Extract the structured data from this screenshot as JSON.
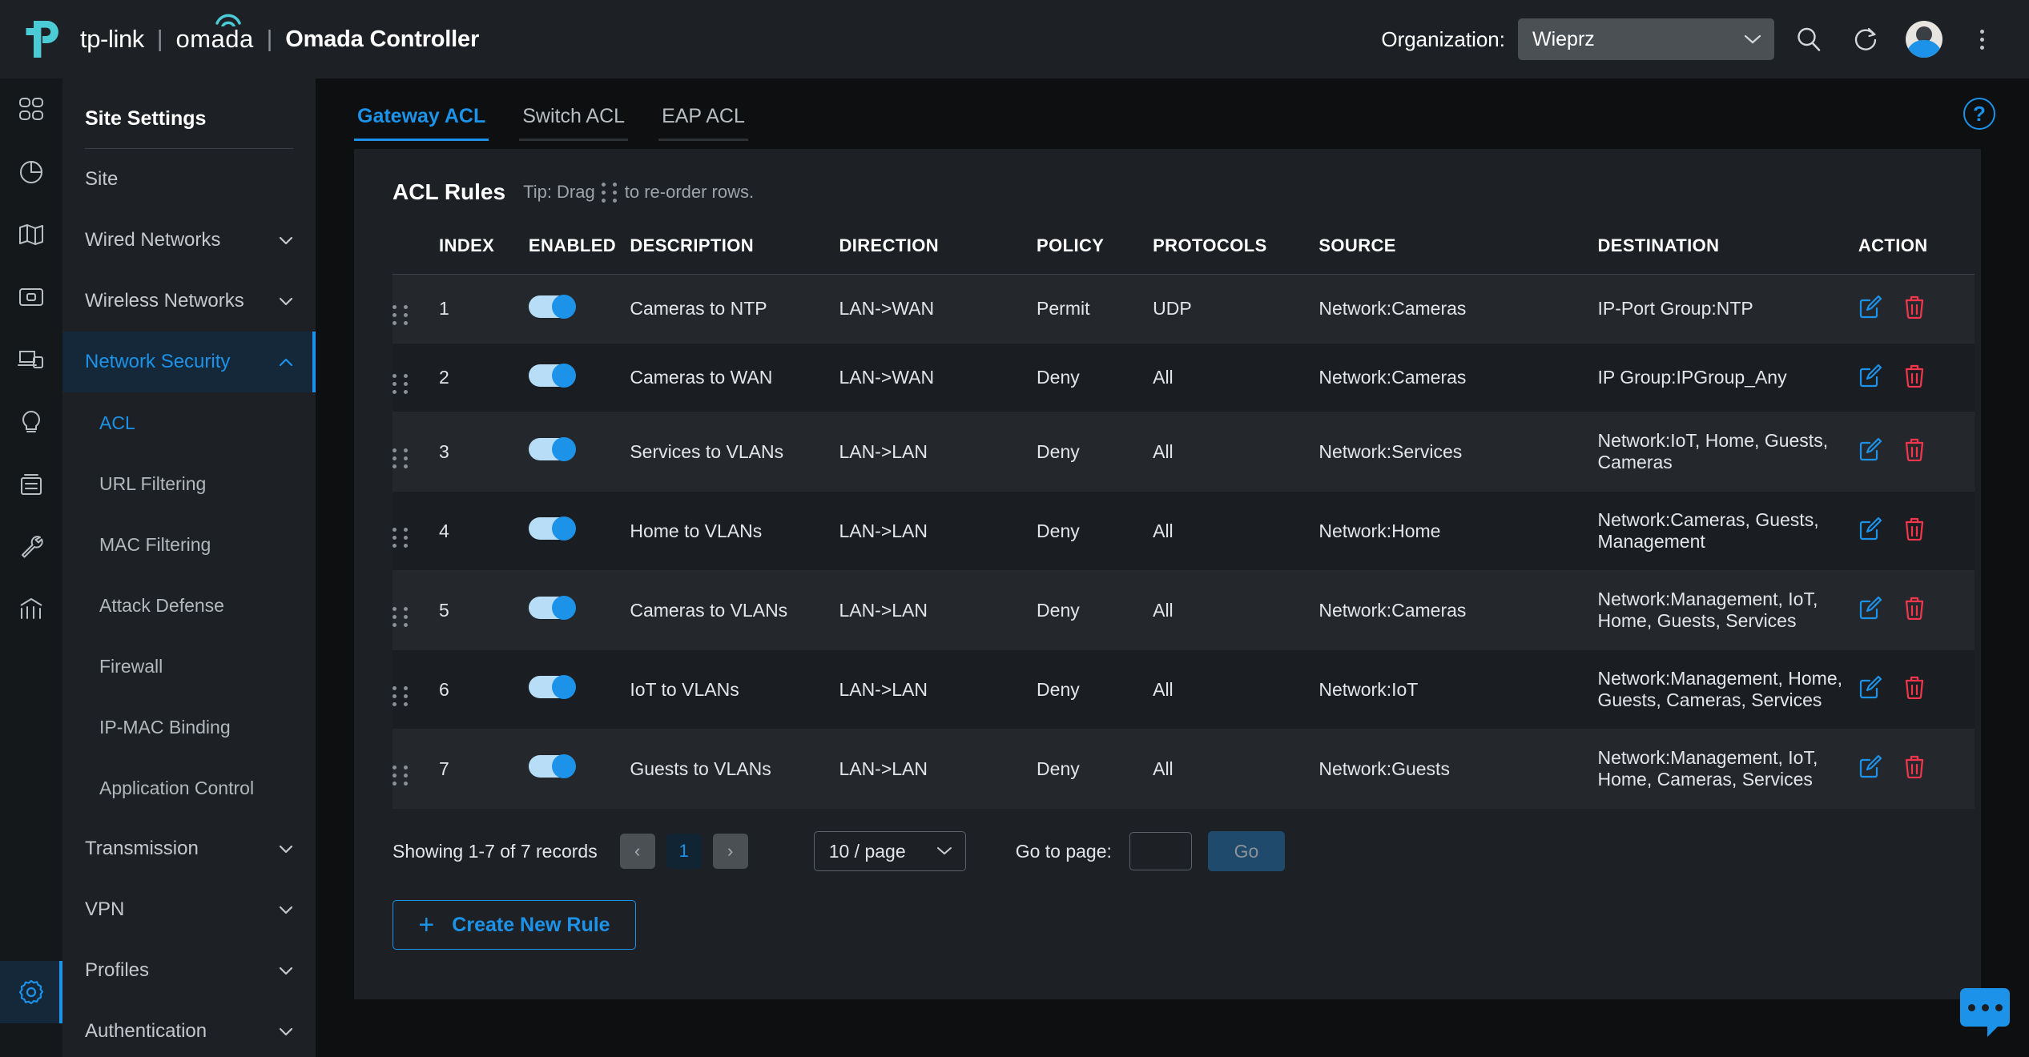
{
  "header": {
    "brand_tp": "tp-link",
    "brand_omada": "omada",
    "brand_sep": "|",
    "app_title": "Omada Controller",
    "org_label": "Organization:",
    "org_value": "Wieprz",
    "search_icon": "search-icon",
    "refresh_icon": "refresh-icon",
    "avatar_icon": "user-avatar",
    "menu_icon": "kebab-menu-icon"
  },
  "rail": {
    "items": [
      {
        "name": "dashboard",
        "icon": "grid-icon",
        "active": false
      },
      {
        "name": "statistics",
        "icon": "pie-chart-icon",
        "active": false
      },
      {
        "name": "map",
        "icon": "map-icon",
        "active": false
      },
      {
        "name": "devices",
        "icon": "device-icon",
        "active": false
      },
      {
        "name": "clients",
        "icon": "clients-icon",
        "active": false
      },
      {
        "name": "insight",
        "icon": "bulb-icon",
        "active": false
      },
      {
        "name": "log",
        "icon": "log-icon",
        "active": false
      },
      {
        "name": "tools",
        "icon": "wrench-icon",
        "active": false
      },
      {
        "name": "reports",
        "icon": "bar-chart-icon",
        "active": false
      }
    ],
    "bottom": {
      "name": "settings",
      "icon": "gear-icon",
      "active": true
    }
  },
  "sidebar": {
    "title": "Site Settings",
    "items": [
      {
        "label": "Site",
        "level": "top",
        "chevron": "none",
        "state": "normal"
      },
      {
        "label": "Wired Networks",
        "level": "top",
        "chevron": "down",
        "state": "normal"
      },
      {
        "label": "Wireless Networks",
        "level": "top",
        "chevron": "down",
        "state": "normal"
      },
      {
        "label": "Network Security",
        "level": "top",
        "chevron": "up",
        "state": "active-parent"
      },
      {
        "label": "ACL",
        "level": "sub",
        "chevron": "none",
        "state": "active"
      },
      {
        "label": "URL Filtering",
        "level": "sub",
        "chevron": "none",
        "state": "normal"
      },
      {
        "label": "MAC Filtering",
        "level": "sub",
        "chevron": "none",
        "state": "normal"
      },
      {
        "label": "Attack Defense",
        "level": "sub",
        "chevron": "none",
        "state": "normal"
      },
      {
        "label": "Firewall",
        "level": "sub",
        "chevron": "none",
        "state": "normal"
      },
      {
        "label": "IP-MAC Binding",
        "level": "sub",
        "chevron": "none",
        "state": "normal"
      },
      {
        "label": "Application Control",
        "level": "sub",
        "chevron": "none",
        "state": "normal"
      },
      {
        "label": "Transmission",
        "level": "top",
        "chevron": "down",
        "state": "normal"
      },
      {
        "label": "VPN",
        "level": "top",
        "chevron": "down",
        "state": "normal"
      },
      {
        "label": "Profiles",
        "level": "top",
        "chevron": "down",
        "state": "normal"
      },
      {
        "label": "Authentication",
        "level": "top",
        "chevron": "down",
        "state": "normal"
      }
    ]
  },
  "main": {
    "tabs": [
      {
        "label": "Gateway ACL",
        "active": true
      },
      {
        "label": "Switch ACL",
        "active": false
      },
      {
        "label": "EAP ACL",
        "active": false
      }
    ],
    "help_icon": "help-question-icon",
    "panel_title": "ACL Rules",
    "tip_before": "Tip: Drag",
    "tip_after": "to re-order rows.",
    "columns": [
      "INDEX",
      "ENABLED",
      "DESCRIPTION",
      "DIRECTION",
      "POLICY",
      "PROTOCOLS",
      "SOURCE",
      "DESTINATION",
      "ACTION"
    ],
    "rows": [
      {
        "index": "1",
        "enabled": true,
        "description": "Cameras to NTP",
        "direction": "LAN->WAN",
        "policy": "Permit",
        "protocols": "UDP",
        "source": "Network:Cameras",
        "destination": "IP-Port Group:NTP"
      },
      {
        "index": "2",
        "enabled": true,
        "description": "Cameras to WAN",
        "direction": "LAN->WAN",
        "policy": "Deny",
        "protocols": "All",
        "source": "Network:Cameras",
        "destination": "IP Group:IPGroup_Any"
      },
      {
        "index": "3",
        "enabled": true,
        "description": "Services to VLANs",
        "direction": "LAN->LAN",
        "policy": "Deny",
        "protocols": "All",
        "source": "Network:Services",
        "destination": "Network:IoT, Home, Guests, Cameras"
      },
      {
        "index": "4",
        "enabled": true,
        "description": "Home to VLANs",
        "direction": "LAN->LAN",
        "policy": "Deny",
        "protocols": "All",
        "source": "Network:Home",
        "destination": "Network:Cameras, Guests, Management"
      },
      {
        "index": "5",
        "enabled": true,
        "description": "Cameras to VLANs",
        "direction": "LAN->LAN",
        "policy": "Deny",
        "protocols": "All",
        "source": "Network:Cameras",
        "destination": "Network:Management, IoT, Home, Guests, Services"
      },
      {
        "index": "6",
        "enabled": true,
        "description": "IoT to VLANs",
        "direction": "LAN->LAN",
        "policy": "Deny",
        "protocols": "All",
        "source": "Network:IoT",
        "destination": "Network:Management, Home, Guests, Cameras, Services"
      },
      {
        "index": "7",
        "enabled": true,
        "description": "Guests to VLANs",
        "direction": "LAN->LAN",
        "policy": "Deny",
        "protocols": "All",
        "source": "Network:Guests",
        "destination": "Network:Management, IoT, Home, Cameras, Services"
      }
    ],
    "pagination": {
      "records_text": "Showing 1-7 of 7 records",
      "prev": "‹",
      "page": "1",
      "next": "›",
      "page_size": "10 / page",
      "goto_label": "Go to page:",
      "goto_value": "",
      "go_label": "Go"
    },
    "create_label": "Create New Rule",
    "create_plus": "+",
    "chat_icon": "chat-bubble-icon"
  },
  "colors": {
    "accent": "#1c92e8",
    "brand_teal": "#4acbd6",
    "danger": "#f4364c",
    "panel_bg": "#1d2125",
    "page_bg": "#0d0f11"
  }
}
